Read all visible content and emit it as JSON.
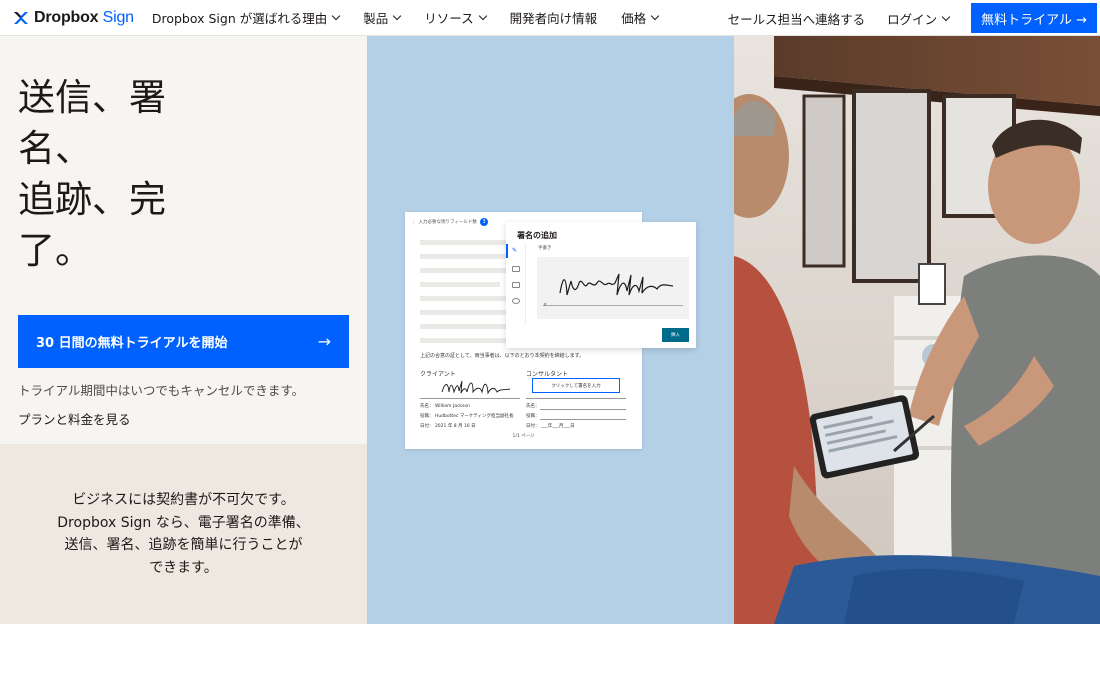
{
  "nav": {
    "logo_text": "Dropbox",
    "logo_sub": "Sign",
    "items": [
      {
        "label": "Dropbox Sign が選ばれる理由",
        "has_dropdown": true
      },
      {
        "label": "製品",
        "has_dropdown": true
      },
      {
        "label": "リソース",
        "has_dropdown": true
      },
      {
        "label": "開発者向け情報",
        "has_dropdown": false
      },
      {
        "label": "価格",
        "has_dropdown": true
      }
    ],
    "contact_sales": "セールス担当へ連絡する",
    "login": "ログイン",
    "trial_button": "無料トライアル →"
  },
  "hero": {
    "title_lines": [
      "送信、署",
      "名、",
      "追跡、完",
      "了。"
    ],
    "cta_label": "30 日間の無料トライアルを開始",
    "cta_arrow": "→",
    "cancel_note": "トライアル期間中はいつでもキャンセルできます。",
    "pricing_link": "プランと料金を見る"
  },
  "description": {
    "lines": [
      "ビジネスには契約書が不可欠です。",
      "Dropbox Sign なら、電子署名の準備、",
      "送信、署名、追跡を簡単に行うことが",
      "できます。"
    ]
  },
  "mockup": {
    "required_label": "入力必要な残りフィールド数",
    "required_count": "3",
    "agreement_text": "上記の合意の証として、両当事者は、以下のとおり本契約を締結します。",
    "client_heading": "クライアント",
    "consultant_heading": "コンサルタント",
    "client_name_label": "氏名：",
    "client_name": "William Jackson",
    "client_role_label": "役職：",
    "client_role": "Hudbottec マーケティング担当副社長",
    "client_date_label": "日付：",
    "client_date": "2021 年 8 月 16 日",
    "consultant_sign_prompt": "クリックして署名を入力",
    "consultant_name_label": "氏名：",
    "consultant_role_label": "役職：",
    "consultant_date_label": "日付：",
    "consultant_date_tpl": "___年___月___日",
    "page_indicator": "1/1 ページ",
    "modal_title": "署名の追加",
    "modal_tab_label": "手書き",
    "modal_clear": "×",
    "modal_insert_button": "挿入"
  },
  "colors": {
    "brand_blue": "#0061fe",
    "hero_bg": "#f7f5f2",
    "desc_bg": "#efe8e0",
    "panel_blue": "#b4d0e7",
    "insert_teal": "#006a8a"
  }
}
